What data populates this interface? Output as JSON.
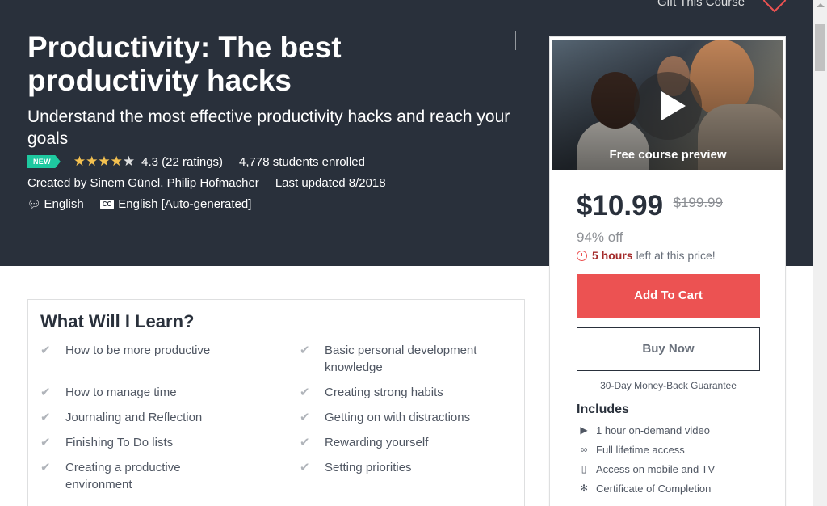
{
  "header": {
    "gift_label": "Gift This Course",
    "title": "Productivity: The best productivity hacks",
    "subtitle": "Understand the most effective productivity hacks and reach your goals",
    "badge": "NEW",
    "rating_value": 4.3,
    "rating_text": "4.3 (22 ratings)",
    "students": "4,778 students enrolled",
    "created_by": "Created by Sinem Günel, Philip Hofmacher",
    "last_updated": "Last updated 8/2018",
    "language": "English",
    "captions": "English [Auto-generated]",
    "cc_label": "CC"
  },
  "colors": {
    "hero_bg": "#29303b",
    "accent_red": "#ec5252",
    "star": "#f4c150",
    "badge_green": "#1ec9a0"
  },
  "sidebar": {
    "preview_label": "Free course preview",
    "price": "$10.99",
    "old_price": "$199.99",
    "discount": "94% off",
    "timer_strong": "5 hours",
    "timer_rest": "left at this price!",
    "add_to_cart": "Add To Cart",
    "buy_now": "Buy Now",
    "guarantee": "30-Day Money-Back Guarantee",
    "includes_title": "Includes",
    "includes": [
      {
        "icon": "video-icon",
        "label": "1 hour on-demand video"
      },
      {
        "icon": "infinity-icon",
        "label": "Full lifetime access"
      },
      {
        "icon": "mobile-icon",
        "label": "Access on mobile and TV"
      },
      {
        "icon": "certificate-icon",
        "label": "Certificate of Completion"
      }
    ]
  },
  "learn": {
    "title": "What Will I Learn?",
    "left": [
      "How to be more productive",
      "How to manage time",
      "Journaling and Reflection",
      "Finishing To Do lists",
      "Creating a productive environment"
    ],
    "right": [
      "Basic personal development knowledge",
      "Creating strong habits",
      "Getting on with distractions",
      "Rewarding yourself",
      "Setting priorities"
    ]
  }
}
